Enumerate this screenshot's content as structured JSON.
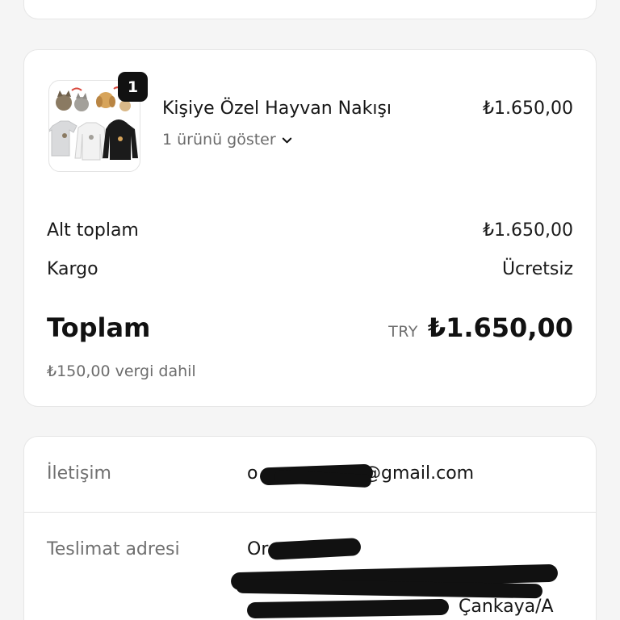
{
  "order_summary": {
    "product": {
      "title": "Kişiye Özel Hayvan Nakışı",
      "price": "₺1.650,00",
      "quantity_badge": "1",
      "variant_toggle_label": "1 ürünü göster"
    },
    "subtotal_label": "Alt toplam",
    "subtotal_value": "₺1.650,00",
    "shipping_label": "Kargo",
    "shipping_value": "Ücretsiz",
    "total_label": "Toplam",
    "currency_code": "TRY",
    "total_value": "₺1.650,00",
    "tax_note": "₺150,00 vergi dahil"
  },
  "customer_info": {
    "contact_label": "İletişim",
    "contact_value_start": "o",
    "contact_value_end": "@gmail.com",
    "address_label": "Teslimat adresi",
    "address_line1_start": "Or",
    "address_line3_end": "Çankaya/A"
  },
  "colors": {
    "background": "#f5f5f5",
    "card": "#ffffff",
    "text": "#111111",
    "muted": "#6d6d6d",
    "badge": "#111111"
  }
}
